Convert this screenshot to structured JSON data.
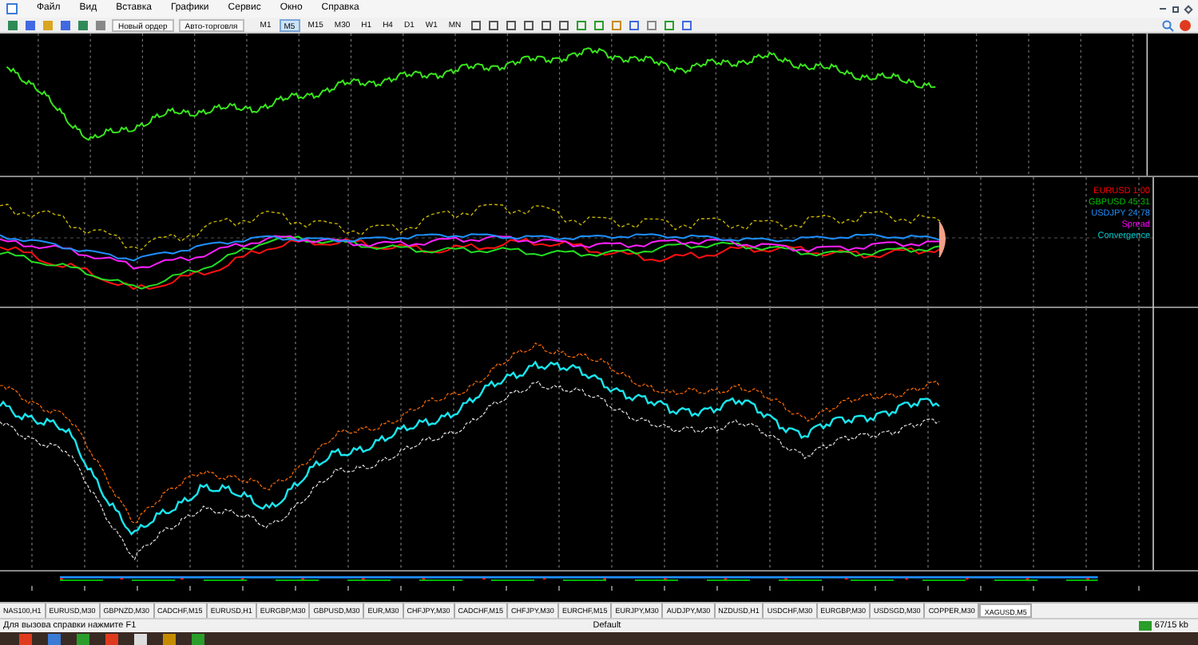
{
  "menu": [
    "Файл",
    "Вид",
    "Вставка",
    "Графики",
    "Сервис",
    "Окно",
    "Справка"
  ],
  "toolbar": {
    "buttons": [
      {
        "label": "Новый ордер"
      },
      {
        "label": "Авто-торговля"
      }
    ],
    "timeframes": [
      {
        "label": "M1",
        "selected": false
      },
      {
        "label": "M5",
        "selected": true
      },
      {
        "label": "M15",
        "selected": false
      },
      {
        "label": "M30",
        "selected": false
      },
      {
        "label": "H1",
        "selected": false
      },
      {
        "label": "H4",
        "selected": false
      },
      {
        "label": "D1",
        "selected": false
      },
      {
        "label": "W1",
        "selected": false
      },
      {
        "label": "MN",
        "selected": false
      }
    ]
  },
  "legend": [
    {
      "label": "EURUSD  1.00",
      "color": "#ff0000"
    },
    {
      "label": "GBPUSD  45.31",
      "color": "#00c000"
    },
    {
      "label": "USDJPY  24.78",
      "color": "#1e90ff"
    },
    {
      "label": "Spread",
      "color": "#ff00ff"
    },
    {
      "label": "Convergence",
      "color": "#00ced1"
    }
  ],
  "tabs": [
    {
      "label": "NAS100,H1",
      "selected": false
    },
    {
      "label": "EURUSD,M30",
      "selected": false
    },
    {
      "label": "GBPNZD,M30",
      "selected": false
    },
    {
      "label": "CADCHF,M15",
      "selected": false
    },
    {
      "label": "EURUSD,H1",
      "selected": false
    },
    {
      "label": "EURGBP,M30",
      "selected": false
    },
    {
      "label": "GBPUSD,M30",
      "selected": false
    },
    {
      "label": "EUR,M30",
      "selected": false
    },
    {
      "label": "CHFJPY,M30",
      "selected": false
    },
    {
      "label": "CADCHF,M15",
      "selected": false
    },
    {
      "label": "CHFJPY,M30",
      "selected": false
    },
    {
      "label": "EURCHF,M15",
      "selected": false
    },
    {
      "label": "EURJPY,M30",
      "selected": false
    },
    {
      "label": "AUDJPY,M30",
      "selected": false
    },
    {
      "label": "NZDUSD,H1",
      "selected": false
    },
    {
      "label": "USDCHF,M30",
      "selected": false
    },
    {
      "label": "EURGBP,M30",
      "selected": false
    },
    {
      "label": "USDSGD,M30",
      "selected": false
    },
    {
      "label": "COPPER,M30",
      "selected": false
    },
    {
      "label": "XAGUSD,M5",
      "selected": true
    }
  ],
  "status_bar": {
    "help": "Для вызова справки нажмите F1",
    "profile": "Default",
    "traffic": "67/15 kb"
  }
}
